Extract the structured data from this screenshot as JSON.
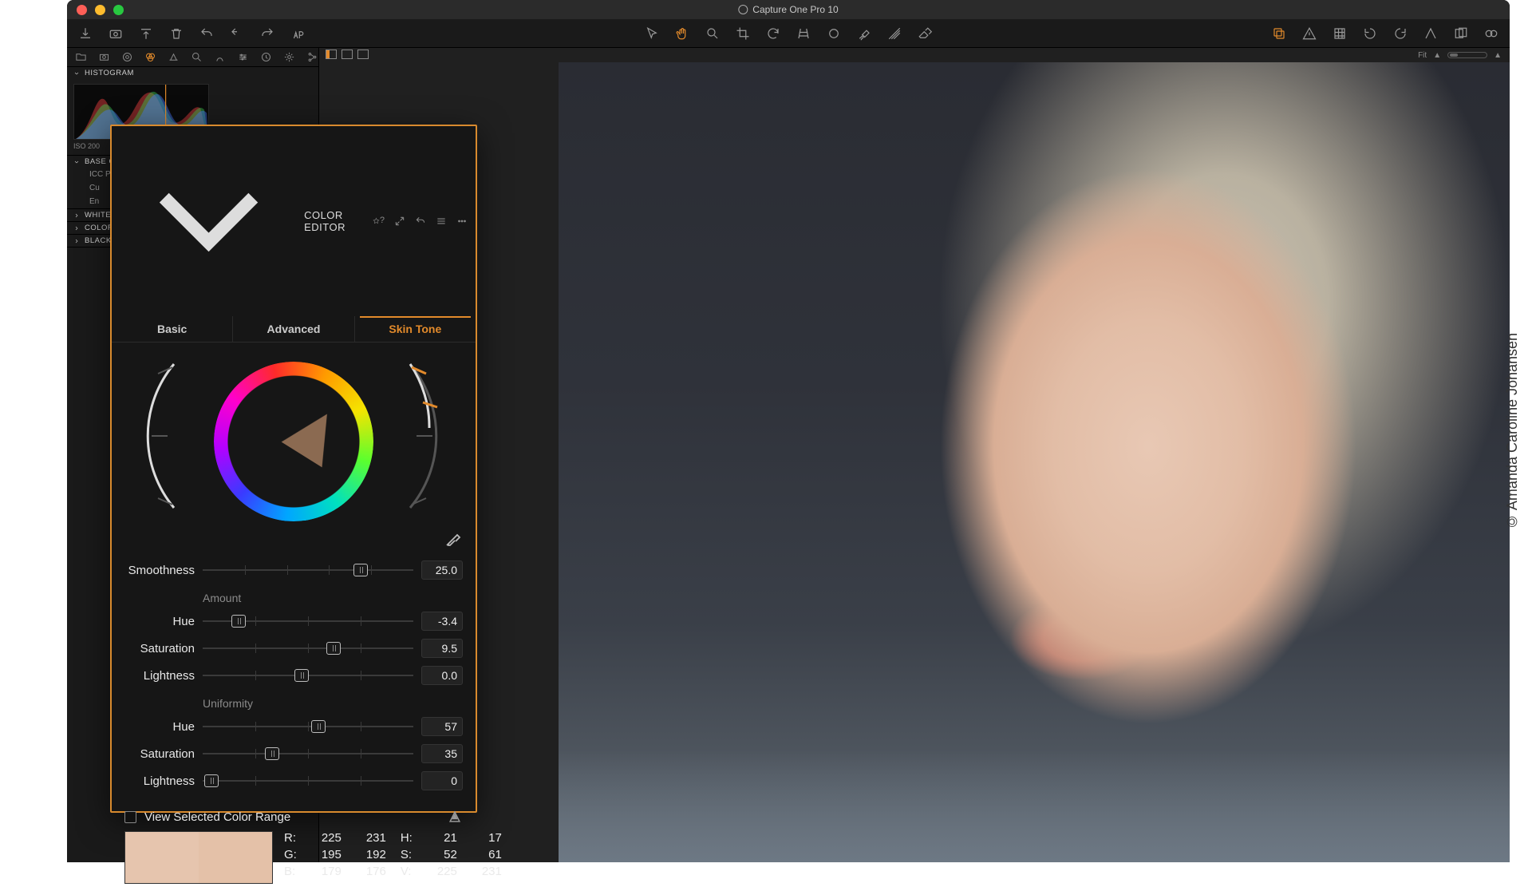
{
  "window": {
    "title": "Capture One Pro 10"
  },
  "viewer": {
    "fit_label": "Fit"
  },
  "left_sidebar": {
    "histogram": {
      "title": "HISTOGRAM",
      "info_label": "ISO 200"
    },
    "sections": [
      {
        "title": "BASE C",
        "items": [
          "ICC Pr",
          "Cu",
          "En"
        ]
      },
      {
        "title": "WHITE"
      },
      {
        "title": "COLOR"
      },
      {
        "title": "BLACK"
      }
    ]
  },
  "panel": {
    "title": "COLOR EDITOR",
    "tabs": {
      "basic": "Basic",
      "advanced": "Advanced",
      "skin": "Skin Tone",
      "active": "skin"
    },
    "smoothness": {
      "label": "Smoothness",
      "value": "25.0",
      "pct": 75
    },
    "amount": {
      "group_label": "Amount",
      "hue": {
        "label": "Hue",
        "value": "-3.4",
        "pct": 17
      },
      "saturation": {
        "label": "Saturation",
        "value": "9.5",
        "pct": 62
      },
      "lightness": {
        "label": "Lightness",
        "value": "0.0",
        "pct": 47
      }
    },
    "uniformity": {
      "group_label": "Uniformity",
      "hue": {
        "label": "Hue",
        "value": "57",
        "pct": 55
      },
      "saturation": {
        "label": "Saturation",
        "value": "35",
        "pct": 33
      },
      "lightness": {
        "label": "Lightness",
        "value": "0",
        "pct": 4
      }
    },
    "view_range": {
      "label": "View Selected Color Range",
      "checked": false
    },
    "readout": {
      "R": [
        "225",
        "231"
      ],
      "G": [
        "195",
        "192"
      ],
      "B": [
        "179",
        "176"
      ],
      "H": [
        "21",
        "17"
      ],
      "S": [
        "52",
        "61"
      ],
      "V": [
        "225",
        "231"
      ]
    },
    "swatches": [
      "#e6c5ae",
      "#e4c1a8"
    ]
  },
  "credit": "© Amanda Caroline Johansen"
}
